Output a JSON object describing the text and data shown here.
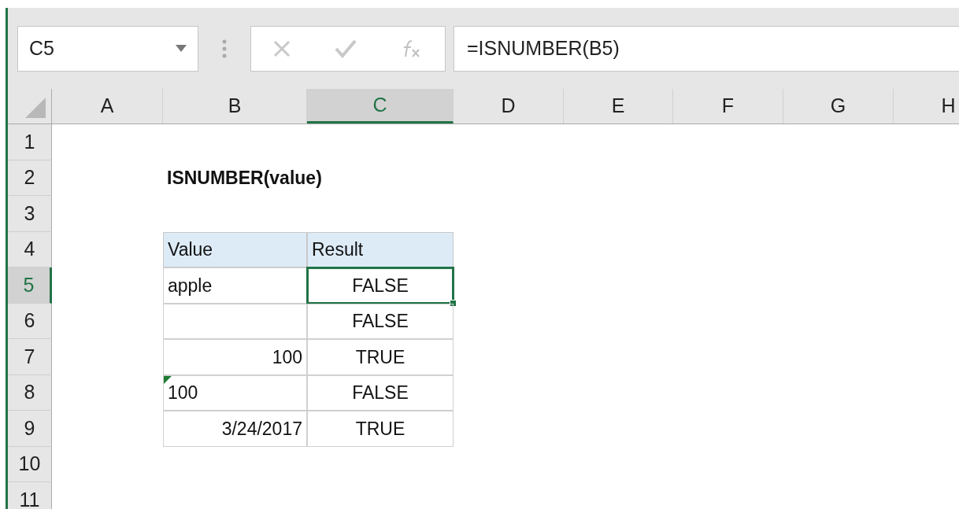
{
  "name_box": {
    "value": "C5"
  },
  "formula_bar": {
    "value": "=ISNUMBER(B5)"
  },
  "columns": [
    {
      "label": "A",
      "selected": false
    },
    {
      "label": "B",
      "selected": false
    },
    {
      "label": "C",
      "selected": true
    },
    {
      "label": "D",
      "selected": false
    },
    {
      "label": "E",
      "selected": false
    },
    {
      "label": "F",
      "selected": false
    },
    {
      "label": "G",
      "selected": false
    },
    {
      "label": "H",
      "selected": false
    }
  ],
  "rows": [
    {
      "header": "1",
      "selected": false,
      "cells": []
    },
    {
      "header": "2",
      "selected": false,
      "cells": [
        {
          "kind": "title",
          "text": "ISNUMBER(value)",
          "selected": false
        }
      ]
    },
    {
      "header": "3",
      "selected": false,
      "cells": []
    },
    {
      "header": "4",
      "selected": false,
      "cells": [
        {
          "kind": "header",
          "text": "Value",
          "selected": false
        },
        {
          "kind": "header",
          "text": "Result",
          "selected": false
        }
      ]
    },
    {
      "header": "5",
      "selected": true,
      "cells": [
        {
          "kind": "text",
          "text": "apple",
          "selected": false
        },
        {
          "kind": "boolean",
          "text": "FALSE",
          "selected": true
        }
      ]
    },
    {
      "header": "6",
      "selected": false,
      "cells": [
        {
          "kind": "empty",
          "selected": false
        },
        {
          "kind": "boolean",
          "text": "FALSE",
          "selected": false
        }
      ]
    },
    {
      "header": "7",
      "selected": false,
      "cells": [
        {
          "kind": "number",
          "text": "100",
          "selected": false
        },
        {
          "kind": "boolean",
          "text": "TRUE",
          "selected": false
        }
      ]
    },
    {
      "header": "8",
      "selected": false,
      "cells": [
        {
          "kind": "text",
          "text": "100",
          "flag": true,
          "selected": false
        },
        {
          "kind": "boolean",
          "text": "FALSE",
          "selected": false
        }
      ]
    },
    {
      "header": "9",
      "selected": false,
      "cells": [
        {
          "kind": "number",
          "text": "3/24/2017",
          "selected": false
        },
        {
          "kind": "boolean",
          "text": "TRUE",
          "selected": false
        }
      ]
    },
    {
      "header": "10",
      "selected": false,
      "cells": []
    },
    {
      "header": "11",
      "selected": false,
      "cells": []
    }
  ]
}
